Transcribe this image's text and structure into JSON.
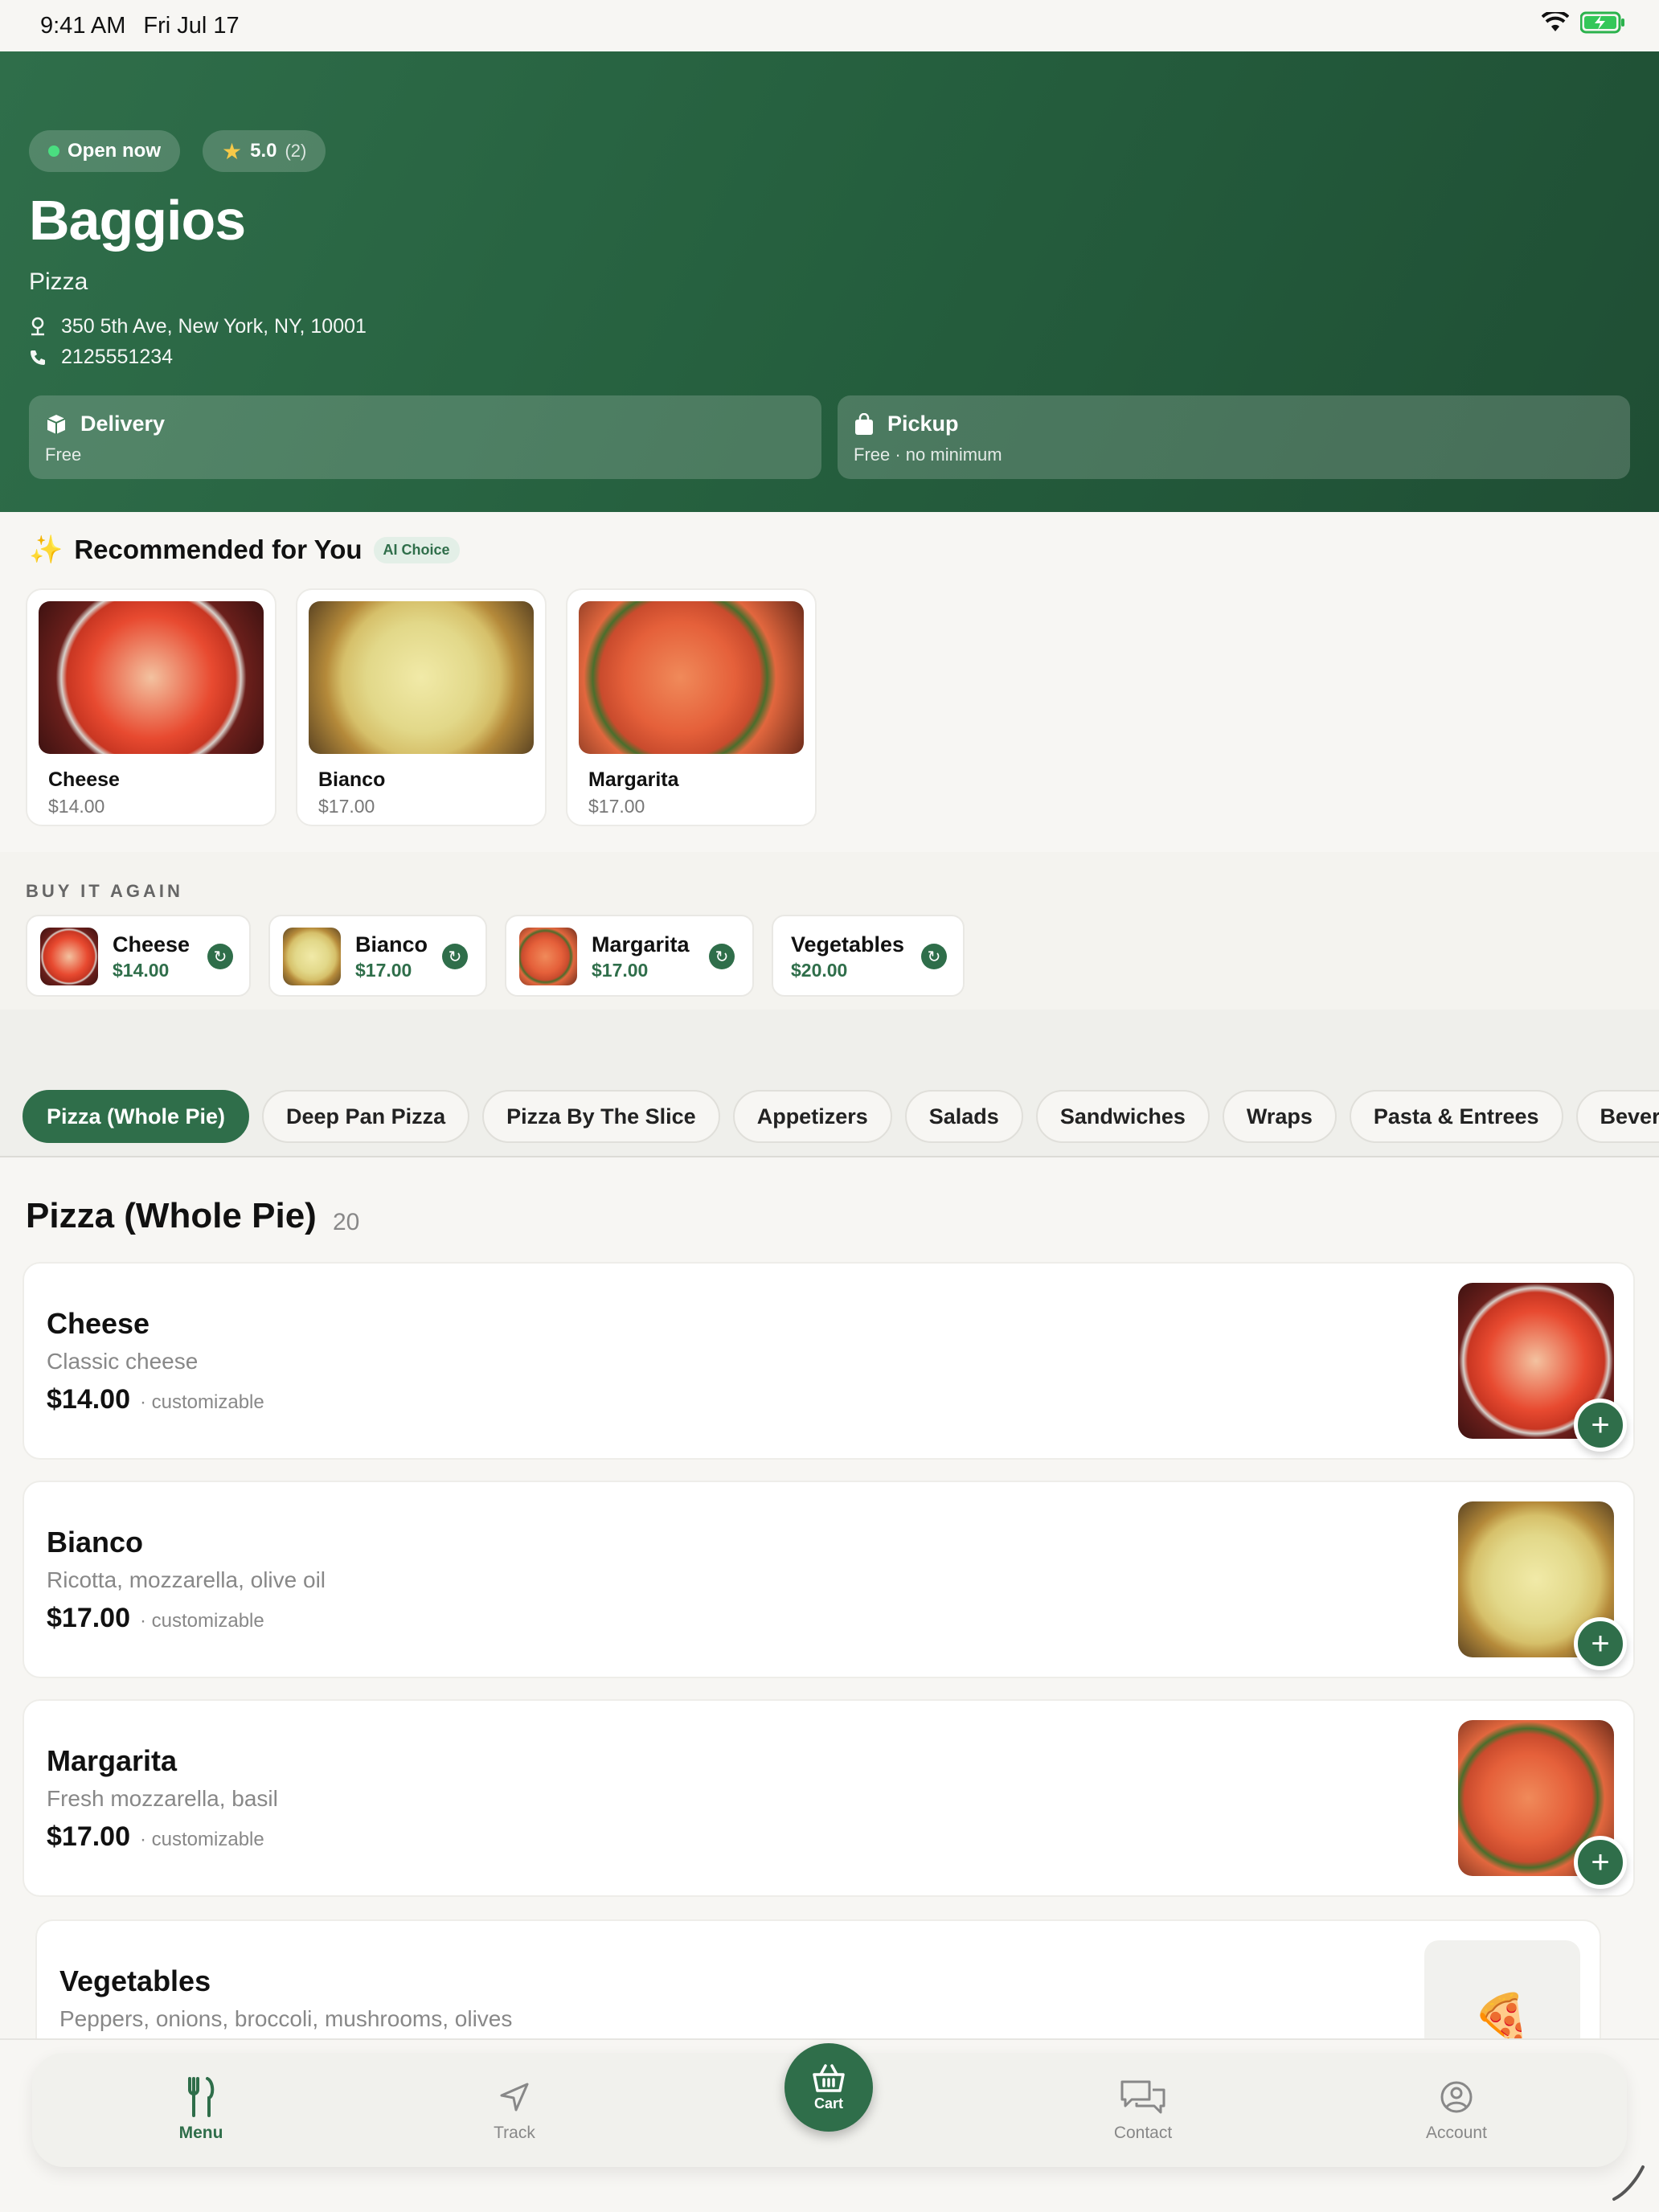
{
  "status": {
    "time": "9:41 AM",
    "date": "Fri Jul 17"
  },
  "restaurant": {
    "open_label": "Open now",
    "rating": "5.0",
    "rating_count": "(2)",
    "name": "Baggios",
    "category": "Pizza",
    "address": "350 5th Ave, New York, NY, 10001",
    "phone": "2125551234"
  },
  "modes": {
    "delivery": {
      "title": "Delivery",
      "sub": "Free"
    },
    "pickup": {
      "title": "Pickup",
      "sub": "Free · no minimum"
    }
  },
  "recommended": {
    "title": "Recommended for You",
    "tag": "AI Choice",
    "items": [
      {
        "name": "Cheese",
        "price": "$14.00"
      },
      {
        "name": "Bianco",
        "price": "$17.00"
      },
      {
        "name": "Margarita",
        "price": "$17.00"
      }
    ]
  },
  "buy_again": {
    "title": "BUY IT AGAIN",
    "items": [
      {
        "name": "Cheese",
        "price": "$14.00"
      },
      {
        "name": "Bianco",
        "price": "$17.00"
      },
      {
        "name": "Margarita",
        "price": "$17.00"
      },
      {
        "name": "Vegetables",
        "price": "$20.00"
      }
    ]
  },
  "tabs": [
    "Pizza (Whole Pie)",
    "Deep Pan Pizza",
    "Pizza By The Slice",
    "Appetizers",
    "Salads",
    "Sandwiches",
    "Wraps",
    "Pasta & Entrees",
    "Beverages"
  ],
  "section": {
    "title": "Pizza (Whole Pie)",
    "count": "20"
  },
  "menu_items": [
    {
      "name": "Cheese",
      "desc": "Classic cheese",
      "price": "$14.00",
      "note": "· customizable"
    },
    {
      "name": "Bianco",
      "desc": "Ricotta, mozzarella, olive oil",
      "price": "$17.00",
      "note": "· customizable"
    },
    {
      "name": "Margarita",
      "desc": "Fresh mozzarella, basil",
      "price": "$17.00",
      "note": "· customizable"
    },
    {
      "name": "Vegetables",
      "desc": "Peppers, onions, broccoli, mushrooms, olives",
      "price": "",
      "note": ""
    }
  ],
  "nav": {
    "menu": "Menu",
    "track": "Track",
    "cart": "Cart",
    "contact": "Contact",
    "account": "Account"
  },
  "colors": {
    "brand": "#2f6e4a",
    "background": "#f7f6f3"
  }
}
